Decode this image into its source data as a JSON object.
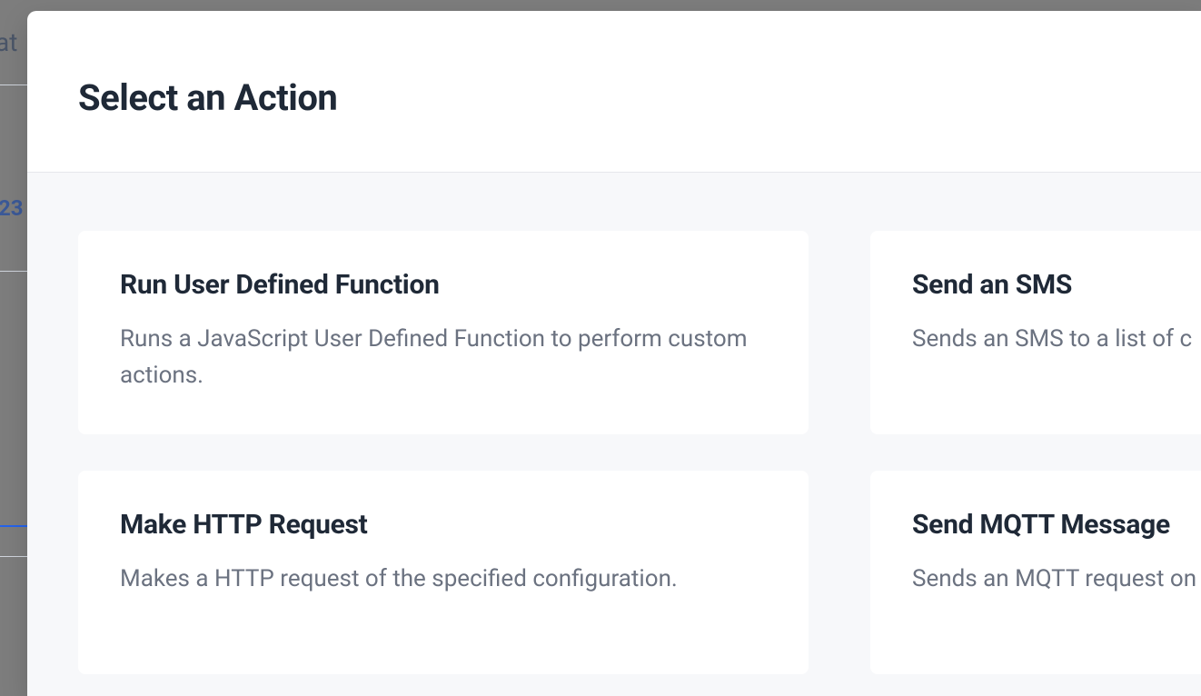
{
  "backdrop": {
    "fragment_text": "at",
    "fragment_number": "23"
  },
  "modal": {
    "title": "Select an Action",
    "actions": [
      {
        "title": "Run User Defined Function",
        "description": "Runs a JavaScript User Defined Function to perform custom actions."
      },
      {
        "title": "Send an SMS",
        "description": "Sends an SMS to a list of c"
      },
      {
        "title": "Make HTTP Request",
        "description": "Makes a HTTP request of the specified configuration."
      },
      {
        "title": "Send MQTT Message",
        "description": "Sends an MQTT request on optional payload."
      }
    ]
  }
}
